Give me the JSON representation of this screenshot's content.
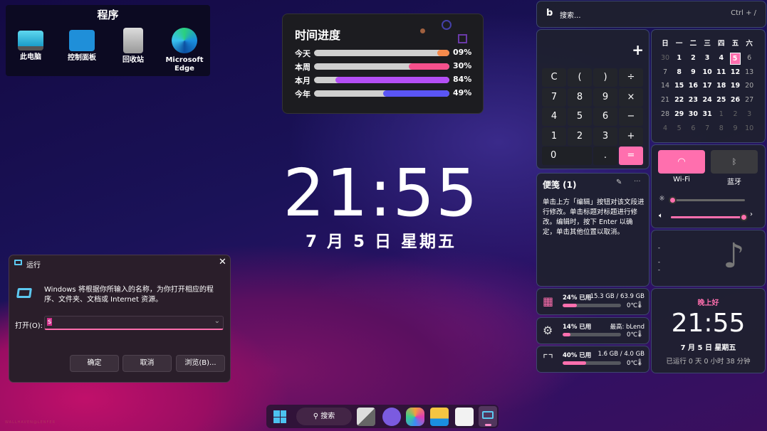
{
  "programs": {
    "title": "程序",
    "items": [
      {
        "label": "此电脑"
      },
      {
        "label": "控制面板"
      },
      {
        "label": "回收站"
      },
      {
        "label": "Microsoft Edge"
      }
    ]
  },
  "time_progress": {
    "title": "时间进度",
    "rows": [
      {
        "label": "今天",
        "percent": 9,
        "text": "09%",
        "color": "#f58a4c"
      },
      {
        "label": "本周",
        "percent": 30,
        "text": "30%",
        "color": "#f5508c"
      },
      {
        "label": "本月",
        "percent": 84,
        "text": "84%",
        "color": "#b44ef5"
      },
      {
        "label": "今年",
        "percent": 49,
        "text": "49%",
        "color": "#5a55f5"
      }
    ]
  },
  "desktop_clock": {
    "time": "21:55",
    "date": "7 月 5 日 星期五"
  },
  "run_dialog": {
    "title": "运行",
    "description": "Windows 将根据你所输入的名称，为你打开相应的程序、文件夹、文档或 Internet 资源。",
    "open_label": "打开(O):",
    "input_value": "s",
    "ok": "确定",
    "cancel": "取消",
    "browse": "浏览(B)..."
  },
  "taskbar": {
    "search_label": "搜索"
  },
  "search": {
    "placeholder": "搜索...",
    "shortcut": "Ctrl + /"
  },
  "calculator": {
    "display": "+",
    "keys": [
      "C",
      "(",
      ")",
      "÷",
      "7",
      "8",
      "9",
      "×",
      "4",
      "5",
      "6",
      "−",
      "1",
      "2",
      "3",
      "+",
      "0",
      ".",
      "="
    ]
  },
  "calendar": {
    "weekdays": [
      "日",
      "一",
      "二",
      "三",
      "四",
      "五",
      "六"
    ],
    "days": [
      "30",
      "1",
      "2",
      "3",
      "4",
      "5",
      "6",
      "7",
      "8",
      "9",
      "10",
      "11",
      "12",
      "13",
      "14",
      "15",
      "16",
      "17",
      "18",
      "19",
      "20",
      "21",
      "22",
      "23",
      "24",
      "25",
      "26",
      "27",
      "28",
      "29",
      "30",
      "31",
      "1",
      "2",
      "3",
      "4",
      "5",
      "6",
      "7",
      "8",
      "9",
      "10"
    ],
    "current_month_range": [
      1,
      31
    ],
    "today_index": 5
  },
  "quick": {
    "wifi": "Wi-Fi",
    "bluetooth": "蓝牙",
    "brightness": 0.02,
    "volume": 0.98
  },
  "notes": {
    "title": "便笺 (1)",
    "body": "单击上方「编辑」按钮对该文段进行修改。单击标题对标题进行修改。编辑时，按下 Enter 以确定，单击其他位置以取消。"
  },
  "music": {
    "line1": "-",
    "line2": "-",
    "line3": "-"
  },
  "system": {
    "disk": {
      "used": "24% 已用",
      "detail": "15.3 GB / 63.9 GB",
      "temp": "0℃",
      "percent": 24
    },
    "cpu": {
      "used": "14% 已用",
      "detail": "最高: bLend",
      "temp": "0℃",
      "percent": 14
    },
    "memory": {
      "used": "40% 已用",
      "detail": "1.6 GB / 4.0 GB",
      "temp": "0℃",
      "percent": 40
    }
  },
  "widget_clock": {
    "greeting": "晚上好",
    "time": "21:55",
    "date": "7 月 5 日 星期五",
    "uptime": "已运行 0 天 0 小时 38 分钟"
  },
  "colors": {
    "accent": "#ff6fae"
  },
  "watermark": "WALLHAVEN@LENFER"
}
